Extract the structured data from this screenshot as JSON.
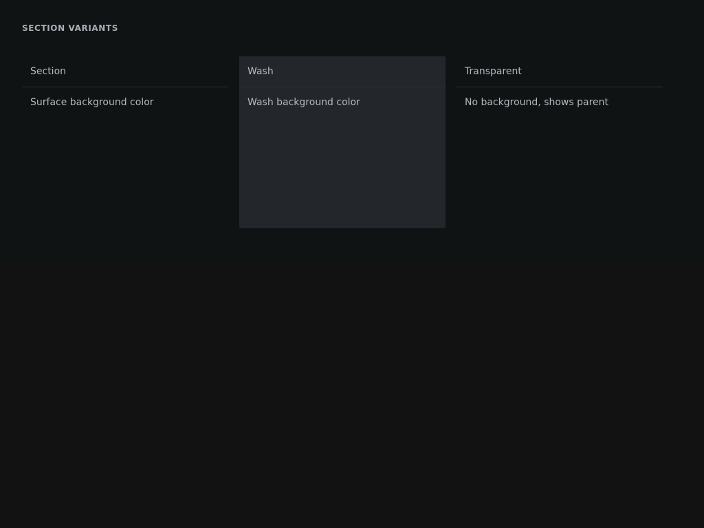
{
  "page": {
    "heading": "SECTION VARIANTS"
  },
  "panels": [
    {
      "title": "Section",
      "description": "Surface background color"
    },
    {
      "title": "Wash",
      "description": "Wash background color"
    },
    {
      "title": "Transparent",
      "description": "No background, shows parent"
    }
  ],
  "colors": {
    "page_background": "#121212",
    "demo_background": "#101314",
    "wash_background": "#23272c",
    "divider": "#2d3237",
    "text": "#b3b8bf"
  }
}
